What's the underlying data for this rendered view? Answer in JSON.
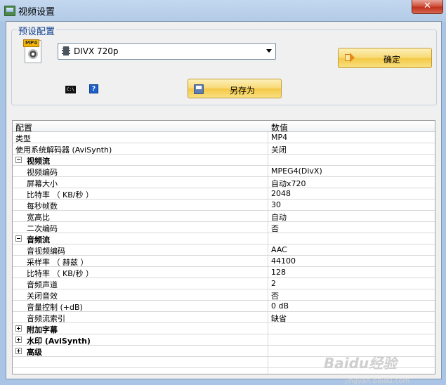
{
  "window": {
    "title": "视频设置",
    "close_label": "✕"
  },
  "preset": {
    "group_label": "预设配置",
    "format_badge": "MP4",
    "selected_profile": "DIVX 720p",
    "ok_label": "确定",
    "save_as_label": "另存为",
    "cmd_label": "C:\\",
    "help_label": "?"
  },
  "grid": {
    "headers": {
      "name": "配置",
      "value": "数值"
    },
    "rows": [
      {
        "kind": "item",
        "name": "类型",
        "value": "MP4"
      },
      {
        "kind": "item",
        "name": "使用系统解码器 (AviSynth)",
        "value": "关闭"
      },
      {
        "kind": "group",
        "name": "视频流",
        "expanded": true
      },
      {
        "kind": "child",
        "name": "视频编码",
        "value": "MPEG4(DivX)"
      },
      {
        "kind": "child",
        "name": "屏幕大小",
        "value": "自动x720"
      },
      {
        "kind": "child",
        "name": "比特率 （ KB/秒 ）",
        "value": "2048"
      },
      {
        "kind": "child",
        "name": "每秒帧数",
        "value": "30"
      },
      {
        "kind": "child",
        "name": "宽高比",
        "value": "自动"
      },
      {
        "kind": "child",
        "name": "二次编码",
        "value": "否"
      },
      {
        "kind": "group",
        "name": "音频流",
        "expanded": true
      },
      {
        "kind": "child",
        "name": "音视频编码",
        "value": "AAC"
      },
      {
        "kind": "child",
        "name": "采样率 （ 赫兹 ）",
        "value": "44100"
      },
      {
        "kind": "child",
        "name": "比特率 （ KB/秒 ）",
        "value": "128"
      },
      {
        "kind": "child",
        "name": "音频声道",
        "value": "2"
      },
      {
        "kind": "child",
        "name": "关闭音效",
        "value": "否"
      },
      {
        "kind": "child",
        "name": "音量控制 (+dB)",
        "value": "0 dB"
      },
      {
        "kind": "child",
        "name": "音频流索引",
        "value": "缺省"
      },
      {
        "kind": "group",
        "name": "附加字幕",
        "expanded": false
      },
      {
        "kind": "group",
        "name": "水印 (AviSynth)",
        "expanded": false
      },
      {
        "kind": "group",
        "name": "高级",
        "expanded": false
      }
    ]
  },
  "watermark": {
    "text": "Baidu经验",
    "sub": "jingyan.baidu.com"
  }
}
